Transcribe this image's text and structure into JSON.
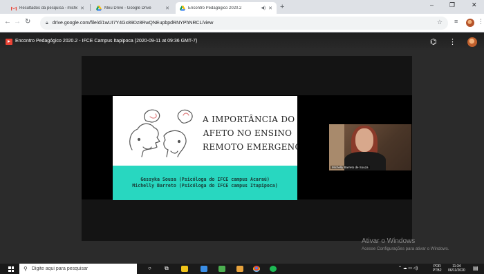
{
  "browser": {
    "tabs": [
      {
        "title": "Resultados da pesquisa - michel",
        "icon": "gmail-icon"
      },
      {
        "title": "Meu Drive - Google Drive",
        "icon": "drive-icon"
      },
      {
        "title": "Encontro Pedagógico 2020.2",
        "icon": "drive-icon"
      }
    ],
    "new_tab": "+",
    "minimize": "–",
    "maximize": "❐",
    "close": "✕",
    "url": "drive.google.com/file/d/1wUI7Y4Gx89Dz8RwQNEupbpdRNYPhNRCL/view"
  },
  "viewer": {
    "file_title": "Encontro Pedagógico 2020.2 - IFCE Campus Itapipoca (2020-09-11 at 09:36 GMT-7)"
  },
  "slide": {
    "title_lines": [
      "A IMPORTÂNCIA DO",
      "AFETO NO ENSINO",
      "REMOTO EMERGENCIAL"
    ],
    "presenter_1": "Gessyka Sousa (Psicóloga do IFCE campus Acaraú)",
    "presenter_2": "Michelly Barreto (Psicóloga do IFCE campus Itapipoca)",
    "band_color": "#28d7c0"
  },
  "camera": {
    "participant_name": "Michelly Barreto de Souza"
  },
  "watermark": {
    "title": "Ativar o Windows",
    "subtitle": "Acesse Configurações para ativar o Windows."
  },
  "taskbar": {
    "search_placeholder": "Digite aqui para pesquisar",
    "language": "POR",
    "language_sub": "PTB2",
    "time": "11:34",
    "date": "06/11/2020"
  }
}
